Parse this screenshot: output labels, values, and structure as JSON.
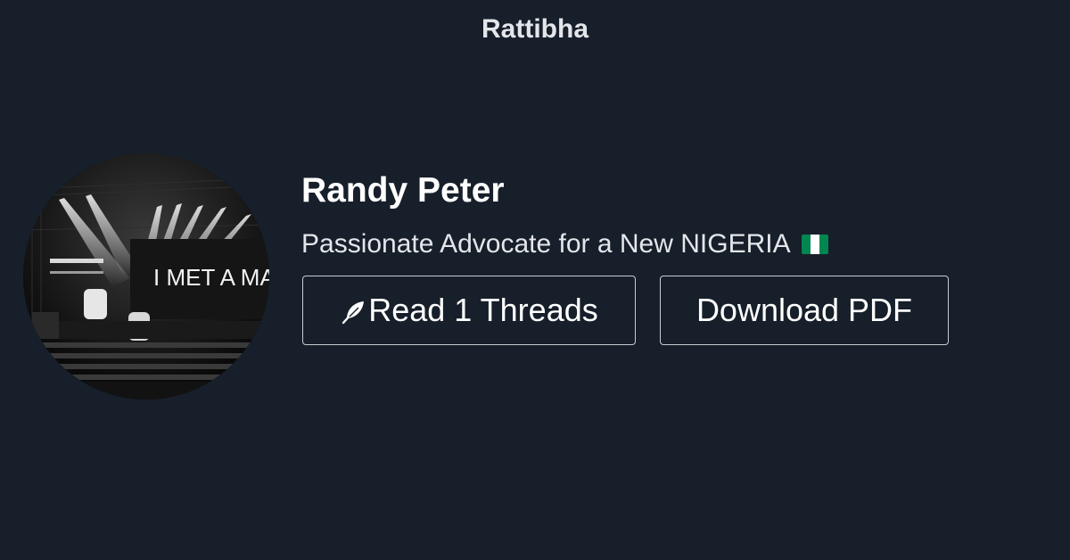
{
  "header": {
    "brand": "Rattibha"
  },
  "profile": {
    "name": "Randy Peter",
    "bio": "Passionate Advocate for a New NIGERIA",
    "bio_flag_icon": "nigeria-flag-icon",
    "avatar_banner_text": "I MET A MA",
    "avatar_icon": "concert-stage-photo"
  },
  "actions": {
    "read_label": "Read 1 Threads",
    "read_icon": "feather-icon",
    "download_label": "Download PDF"
  },
  "colors": {
    "background": "#171f2a",
    "text": "#ffffff",
    "muted_text": "#e3e6ea",
    "button_border": "#c8ccd1",
    "flag_green": "#008751",
    "flag_white": "#ffffff"
  }
}
